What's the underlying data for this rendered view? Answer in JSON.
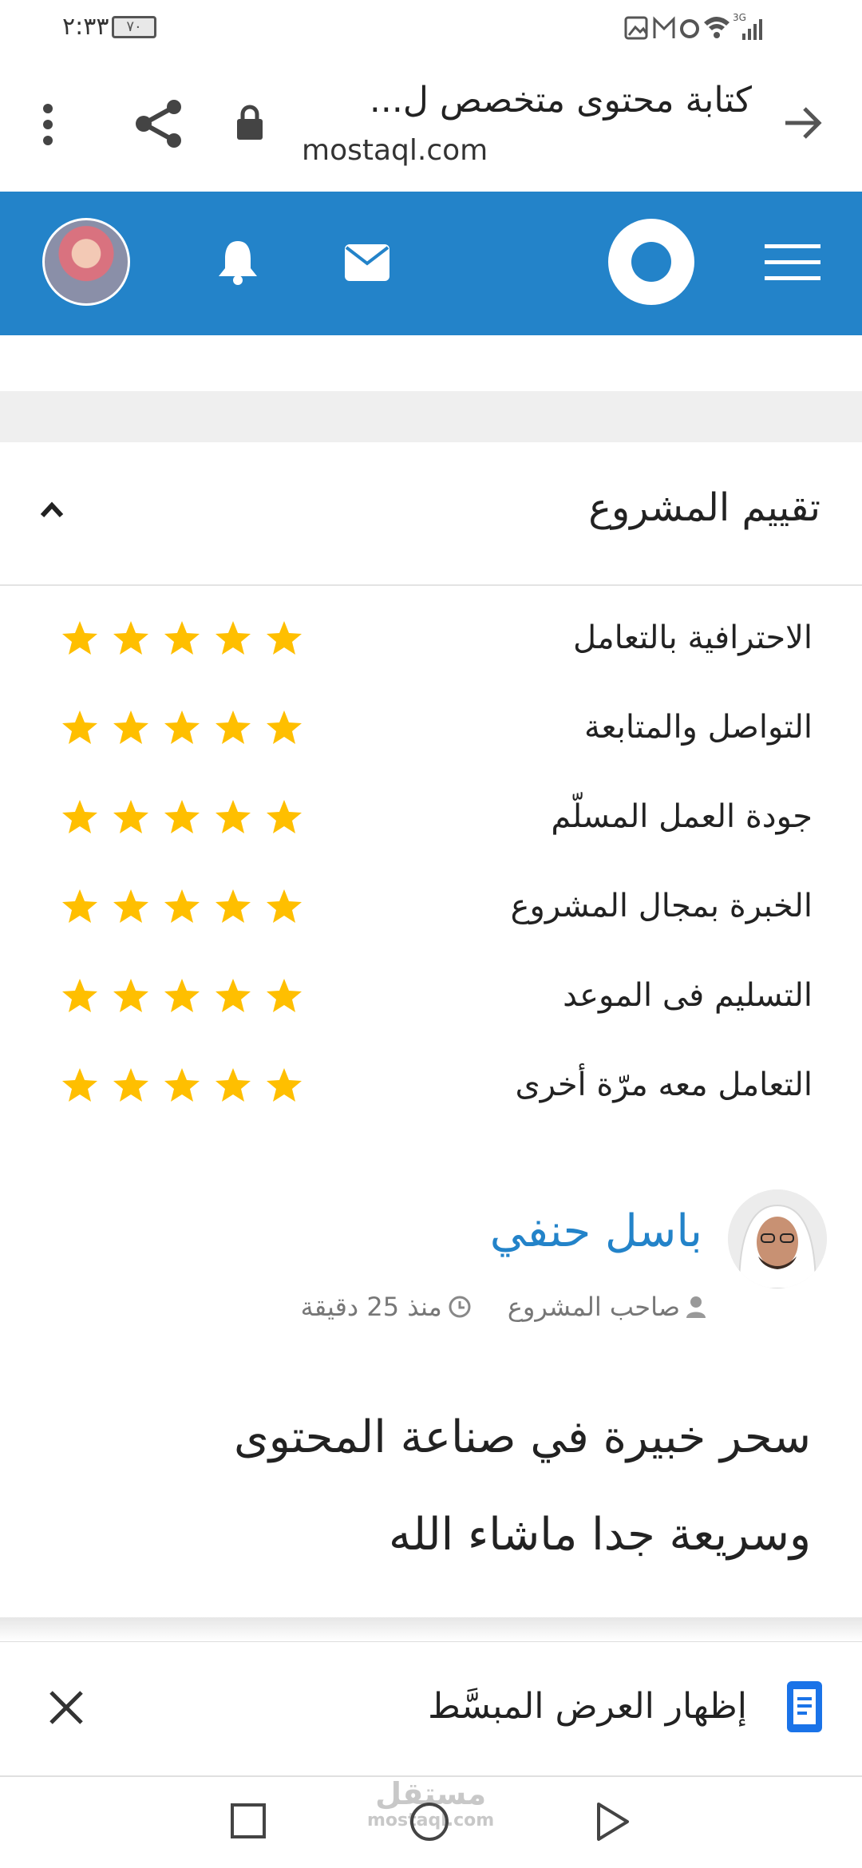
{
  "status_bar": {
    "time": "٢:٣٣",
    "battery": "٧٠",
    "network": "3G"
  },
  "browser": {
    "title": "كتابة محتوى متخصص ل...",
    "domain": "mostaql.com"
  },
  "section": {
    "title": "تقييم المشروع"
  },
  "ratings": [
    {
      "label": "الاحترافية بالتعامل",
      "stars": 5
    },
    {
      "label": "التواصل والمتابعة",
      "stars": 5
    },
    {
      "label": "جودة العمل المسلّم",
      "stars": 5
    },
    {
      "label": "الخبرة بمجال المشروع",
      "stars": 5
    },
    {
      "label": "التسليم فى الموعد",
      "stars": 5
    },
    {
      "label": "التعامل معه مرّة أخرى",
      "stars": 5
    }
  ],
  "reviewer": {
    "name": "باسل حنفي",
    "role": "صاحب المشروع",
    "time_ago": "منذ 25 دقيقة"
  },
  "review": {
    "line1": "سحر خبيرة في صناعة المحتوى",
    "line2": "وسريعة جدا ماشاء الله"
  },
  "simplified_view": {
    "label": "إظهار العرض المبسَّط"
  },
  "watermark": {
    "text": "مستقل",
    "domain": "mostaql.com"
  },
  "colors": {
    "brand_blue": "#2383c9",
    "star": "#ffbf00"
  }
}
